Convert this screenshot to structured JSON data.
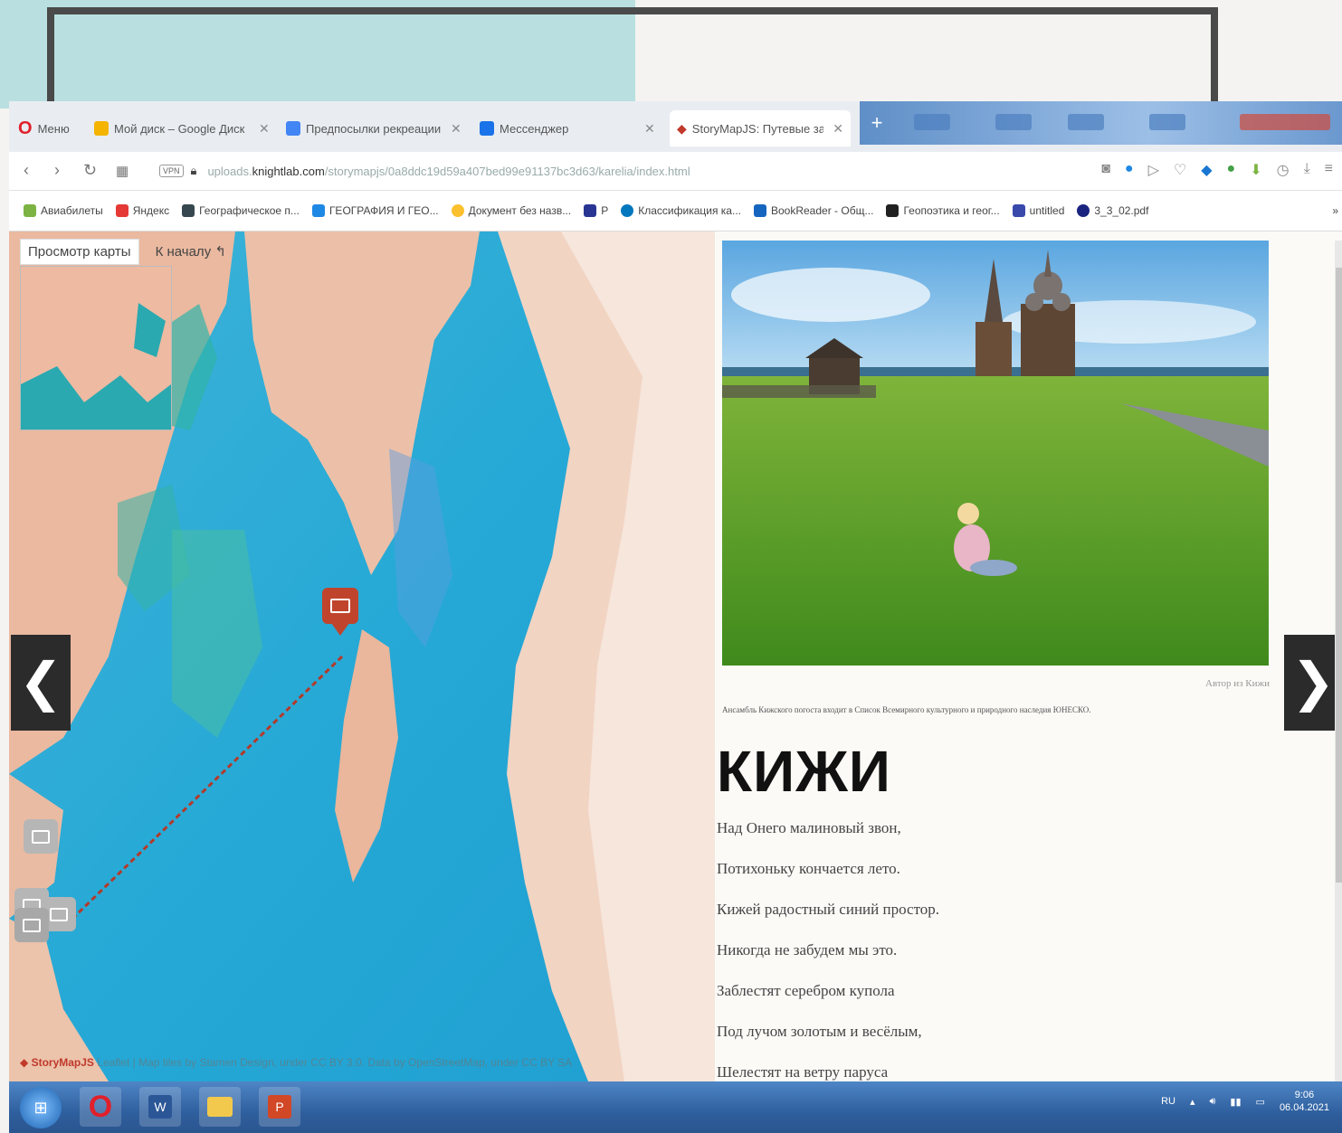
{
  "browser": {
    "menu_label": "Меню",
    "tabs": [
      {
        "label": "Мой диск – Google Диск",
        "color": "#f4b400"
      },
      {
        "label": "Предпосылки рекреации",
        "color": "#4285f4"
      },
      {
        "label": "Мессенджер",
        "color": "#1a73e8"
      },
      {
        "label": "StoryMapJS: Путевые заметки",
        "color": "#c0392b"
      }
    ],
    "url": {
      "prefix": "uploads.",
      "host": "knightlab.com",
      "path": "/storymapjs/0a8ddc19d59a407bed99e91137bc3d63/karelia/index.html",
      "vpn": "VPN"
    },
    "bookmarks": [
      {
        "label": "Авиабилеты",
        "color": "#7cb342"
      },
      {
        "label": "Яндекс",
        "color": "#e53935"
      },
      {
        "label": "Географическое п...",
        "color": "#37474f"
      },
      {
        "label": "ГЕОГРАФИЯ И ГЕО...",
        "color": "#1e88e5"
      },
      {
        "label": "Документ без назв...",
        "color": "#fbc02d"
      },
      {
        "label": "P",
        "color": "#283593"
      },
      {
        "label": "Классификация ка...",
        "color": "#0277bd"
      },
      {
        "label": "BookReader - Общ...",
        "color": "#1565c0"
      },
      {
        "label": "Геопоэтика и геог...",
        "color": "#212121"
      },
      {
        "label": "untitled",
        "color": "#3949ab"
      },
      {
        "label": "3_3_02.pdf",
        "color": "#1a237e"
      }
    ]
  },
  "map": {
    "view_button": "Просмотр карты",
    "home_button": "К началу",
    "attribution_brand": "StoryMapJS",
    "attribution_rest": "Leaflet | Map tiles by Stamen Design, under CC BY 3.0. Data by OpenStreetMap, under CC BY SA",
    "prev_arrow": "❮",
    "next_arrow": "❯"
  },
  "story": {
    "photo_credit": "Автор из Кижи",
    "caption": "Ансамбль Кижского погоста входит в Список Всемирного культурного и природного наследия ЮНЕСКО.",
    "title": "КИЖИ",
    "poem": [
      "Над Онего малиновый звон,",
      "Потихоньку кончается лето.",
      "Кижей радостный синий простор.",
      "Никогда не забудем мы это.",
      "Заблестят серебром купола",
      "Под лучом золотым и весёлым,",
      "Шелестят на ветру паруса"
    ]
  },
  "taskbar": {
    "lang": "RU",
    "time": "9:06",
    "date": "06.04.2021"
  }
}
